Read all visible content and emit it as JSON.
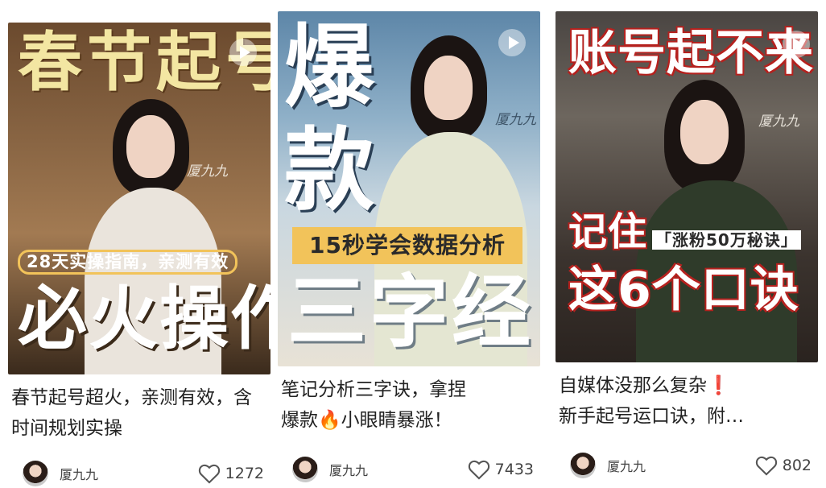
{
  "cards": [
    {
      "cover": {
        "title_top": "春节起号",
        "subtitle": "28天实操指南，亲测有效",
        "title_bottom": "必火操作",
        "signature": "厦九九"
      },
      "caption": "春节起号超火，亲测有效，含时间规划实操",
      "author": "厦九九",
      "likes": "1272"
    },
    {
      "cover": {
        "title_char1": "爆",
        "title_char2": "款",
        "banner": "15秒学会数据分析",
        "title_bottom": "三字经",
        "signature": "厦九九"
      },
      "caption_line1": "笔记分析三字诀，拿捏",
      "caption_line2_a": "爆款",
      "caption_line2_b": "小眼睛暴涨！",
      "author": "厦九九",
      "likes": "7433"
    },
    {
      "cover": {
        "title_top": "账号起不来",
        "line2_a": "记住",
        "line2_b": "「涨粉50万秘诀」",
        "line3": "这6个口诀",
        "signature": "厦九九"
      },
      "caption_line1": "自媒体没那么复杂",
      "caption_line2": "新手起号运口诀，附…",
      "author": "厦九九",
      "likes": "802"
    }
  ],
  "colors": {
    "cover_text_yellow": "#f3e6a2",
    "cover_text_white": "#ffffff",
    "banner_bg": "#f2c35a",
    "red_outline": "#b5211e",
    "caption_text": "#222222",
    "meta_text": "#444444",
    "exclamation_red": "#e03a2f",
    "fire_orange": "#f28a1e"
  },
  "icons": [
    "play-icon",
    "heart-icon",
    "avatar",
    "fire-emoji",
    "exclamation-emoji"
  ]
}
